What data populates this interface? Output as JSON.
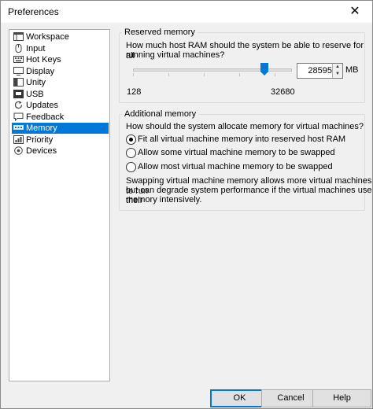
{
  "window": {
    "title": "Preferences",
    "close_glyph": "✕"
  },
  "nav": {
    "items": [
      {
        "label": "Workspace",
        "icon": "workspace-icon",
        "selected": false
      },
      {
        "label": "Input",
        "icon": "input-icon",
        "selected": false
      },
      {
        "label": "Hot Keys",
        "icon": "hot-keys-icon",
        "selected": false
      },
      {
        "label": "Display",
        "icon": "display-icon",
        "selected": false
      },
      {
        "label": "Unity",
        "icon": "unity-icon",
        "selected": false
      },
      {
        "label": "USB",
        "icon": "usb-icon",
        "selected": false
      },
      {
        "label": "Updates",
        "icon": "updates-icon",
        "selected": false
      },
      {
        "label": "Feedback",
        "icon": "feedback-icon",
        "selected": false
      },
      {
        "label": "Memory",
        "icon": "memory-icon",
        "selected": true
      },
      {
        "label": "Priority",
        "icon": "priority-icon",
        "selected": false
      },
      {
        "label": "Devices",
        "icon": "devices-icon",
        "selected": false
      }
    ]
  },
  "reserved": {
    "legend": "Reserved memory",
    "question_line1": "How much host RAM should the system be able to reserve for all",
    "question_line2": "running virtual machines?",
    "value": "28595",
    "unit": "MB",
    "min_label": "128",
    "max_label": "32680"
  },
  "additional": {
    "legend": "Additional memory",
    "question": "How should the system allocate memory for virtual machines?",
    "options": [
      {
        "label": "Fit all virtual machine memory into reserved host RAM",
        "checked": true
      },
      {
        "label": "Allow some virtual machine memory to be swapped",
        "checked": false
      },
      {
        "label": "Allow most virtual machine memory to be swapped",
        "checked": false
      }
    ],
    "note_line1": "Swapping virtual machine memory allows more virtual machines to run",
    "note_line2": "but can degrade system performance if the virtual machines use their",
    "note_line3": "memory intensively."
  },
  "buttons": {
    "ok": "OK",
    "cancel": "Cancel",
    "help": "Help"
  },
  "colors": {
    "selection": "#0078d7",
    "slider_thumb": "#0078d7"
  }
}
